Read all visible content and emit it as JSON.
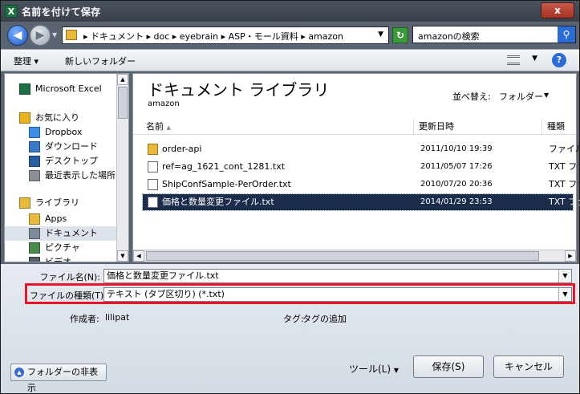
{
  "window": {
    "title": "名前を付けて保存",
    "app_icon": "excel-icon",
    "close_label": "x"
  },
  "nav": {
    "back_icon": "back-arrow-icon",
    "forward_icon": "forward-arrow-icon",
    "address_path": "▸ ドキュメント ▸ doc ▸ eyebrain ▸ ASP・モール資料 ▸ amazon",
    "search_placeholder": "amazonの検索"
  },
  "toolbar": {
    "organize": "整理 ▾",
    "new_folder": "新しいフォルダー",
    "help": "?"
  },
  "sidebar": {
    "items": [
      {
        "label": "Microsoft Excel",
        "icon": "excel-icon",
        "indent": 0,
        "color": "#1e7145"
      },
      {
        "label": "お気に入り",
        "icon": "star-icon",
        "indent": 0,
        "color": "#e8b321"
      },
      {
        "label": "Dropbox",
        "icon": "dropbox-icon",
        "indent": 1,
        "color": "#3d8ee6"
      },
      {
        "label": "ダウンロード",
        "icon": "download-folder-icon",
        "indent": 1,
        "color": "#3b78c8"
      },
      {
        "label": "デスクトップ",
        "icon": "desktop-icon",
        "indent": 1,
        "color": "#2a5f9e"
      },
      {
        "label": "最近表示した場所",
        "icon": "recent-places-icon",
        "indent": 1,
        "color": "#8a8f96"
      },
      {
        "label": "ライブラリ",
        "icon": "library-icon",
        "indent": 0,
        "color": "#e7b93c"
      },
      {
        "label": "Apps",
        "icon": "folder-icon",
        "indent": 1,
        "color": "#e7b93c"
      },
      {
        "label": "ドキュメント",
        "icon": "documents-icon",
        "indent": 1,
        "color": "#7e8a99"
      },
      {
        "label": "ピクチャ",
        "icon": "pictures-icon",
        "indent": 1,
        "color": "#4a8a4a"
      },
      {
        "label": "ビデオ",
        "icon": "videos-icon",
        "indent": 1,
        "color": "#555d66"
      }
    ]
  },
  "main": {
    "library_title": "ドキュメント ライブラリ",
    "library_sub": "amazon",
    "arrange_label": "並べ替え:",
    "arrange_value": "フォルダー",
    "columns": [
      "名前",
      "更新日時",
      "種類"
    ],
    "files": [
      {
        "name": "order-api",
        "date": "2011/10/10 19:39",
        "type": "ファイル",
        "kind": "folder"
      },
      {
        "name": "ref=ag_1621_cont_1281.txt",
        "date": "2011/05/07 17:26",
        "type": "TXT ファ",
        "kind": "doc"
      },
      {
        "name": "ShipConfSample-PerOrder.txt",
        "date": "2010/07/20 20:36",
        "type": "TXT ファ",
        "kind": "doc"
      },
      {
        "name": "価格と数量変更ファイル.txt",
        "date": "2014/01/29 23:53",
        "type": "TXT ファ",
        "kind": "doc"
      }
    ],
    "selected_index": 3
  },
  "form": {
    "filename_label": "ファイル名(N):",
    "filename_value": "価格と数量変更ファイル.txt",
    "filetype_label": "ファイルの種類(T):",
    "filetype_value": "テキスト (タブ区切り) (*.txt)",
    "author_label": "作成者:",
    "author_value": "lilipat",
    "tags_label": "タグ:",
    "tags_value": "タグの追加"
  },
  "buttons": {
    "hide_folders": "フォルダーの非表示",
    "tools": "ツール(L)",
    "save": "保存(S)",
    "cancel": "キャンセル"
  },
  "colors": {
    "highlight_red": "#e8152c",
    "selection": "#1c2d4c"
  }
}
